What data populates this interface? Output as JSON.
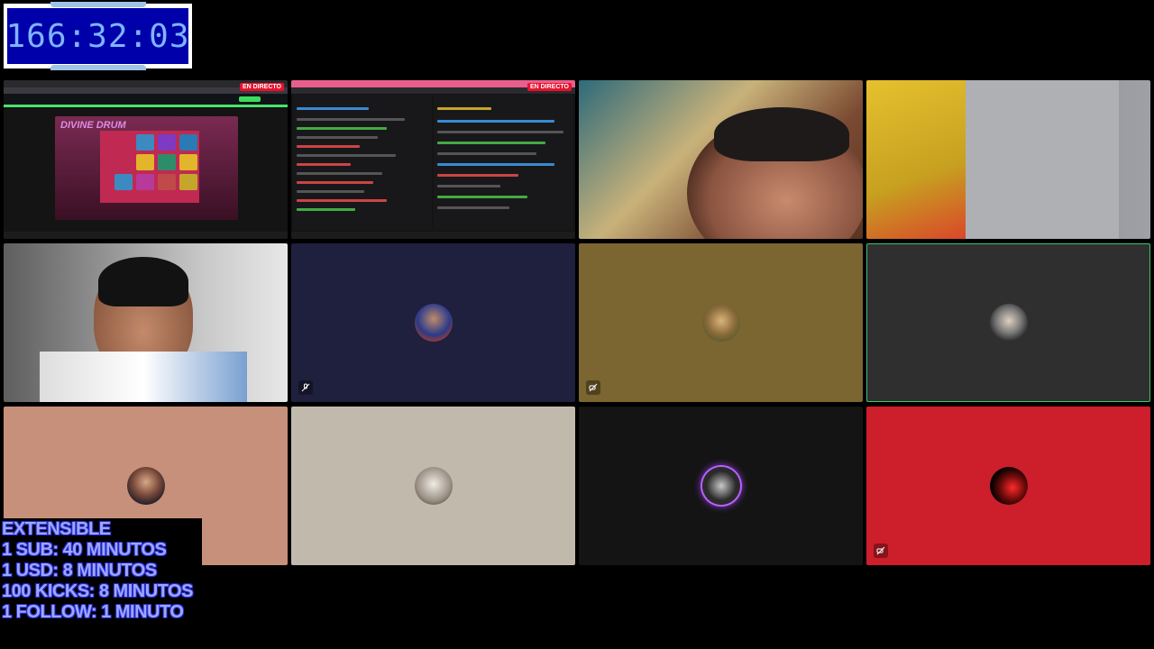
{
  "timer": {
    "value": "166:32:03"
  },
  "screen_shares": {
    "slot": {
      "live_badge": "EN DIRECTO",
      "game_title": "DIVINE DRUM"
    },
    "chat": {
      "live_badge": "EN DIRECTO"
    }
  },
  "tiles": [
    {
      "id": "tile-screen-slot",
      "bg": "#141414"
    },
    {
      "id": "tile-screen-chat",
      "bg": "#141414"
    },
    {
      "id": "tile-cam-face",
      "bg": "#6c4a36"
    },
    {
      "id": "tile-cam-shirt",
      "bg": "#8e8f93"
    },
    {
      "id": "tile-cam-headphones",
      "bg": "#7b7b7b"
    },
    {
      "id": "tile-avatar-navy",
      "bg": "#1f1f3e",
      "status_icon": "mic-muted-icon"
    },
    {
      "id": "tile-avatar-olive",
      "bg": "#7b6530",
      "status_icon": "camera-off-icon"
    },
    {
      "id": "tile-avatar-gray",
      "bg": "#2f2f2f",
      "highlighted": true
    },
    {
      "id": "tile-avatar-salmon",
      "bg": "#c7907a"
    },
    {
      "id": "tile-avatar-beige",
      "bg": "#c1b9ac"
    },
    {
      "id": "tile-avatar-dark",
      "bg": "#141414",
      "speaking": true
    },
    {
      "id": "tile-avatar-red",
      "bg": "#cc1f2b",
      "status_icon": "camera-off-icon"
    }
  ],
  "extensible": {
    "lines": [
      "EXTENSIBLE",
      "1 SUB: 40 MINUTOS",
      "1 USD: 8 MINUTOS",
      "100 KICKS: 8 MINUTOS",
      "1 FOLLOW: 1 MINUTO"
    ]
  },
  "colors": {
    "timer_bg": "#0000aa",
    "timer_text": "#7fb4ff",
    "overlay_text": "#9aa8ff",
    "live_red": "#e8112d",
    "speaking_ring": "#b860ff"
  }
}
